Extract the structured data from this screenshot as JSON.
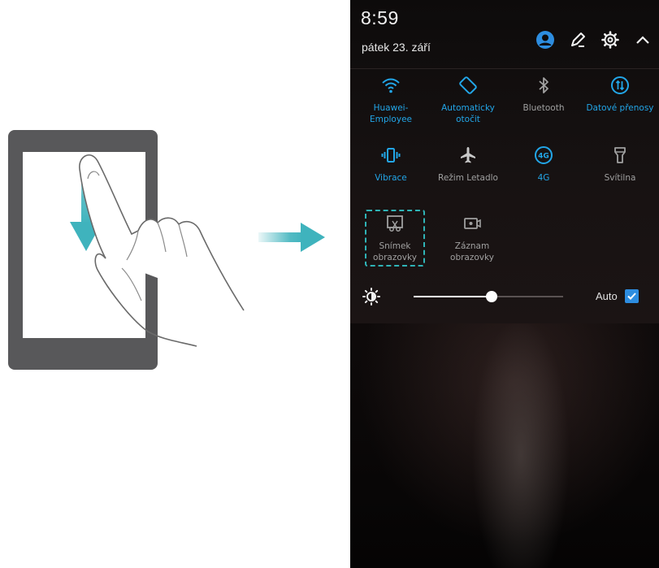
{
  "status": {
    "time": "8:59",
    "date": "pátek 23. září"
  },
  "header_icons": [
    "avatar-icon",
    "edit-icon",
    "settings-icon",
    "collapse-icon"
  ],
  "quick_settings": {
    "row1": [
      {
        "label": "Huawei-\nEmployee",
        "icon": "wifi-icon",
        "state": "on"
      },
      {
        "label": "Automaticky\notočit",
        "icon": "auto-rotate-icon",
        "state": "on"
      },
      {
        "label": "Bluetooth",
        "icon": "bluetooth-icon",
        "state": "off"
      },
      {
        "label": "Datové přenosy",
        "icon": "mobile-data-icon",
        "state": "on"
      }
    ],
    "row2": [
      {
        "label": "Vibrace",
        "icon": "vibrate-icon",
        "state": "on"
      },
      {
        "label": "Režim Letadlo",
        "icon": "airplane-icon",
        "state": "off"
      },
      {
        "label": "4G",
        "icon": "4g-icon",
        "state": "on"
      },
      {
        "label": "Svítilna",
        "icon": "flashlight-icon",
        "state": "off"
      }
    ],
    "row3": [
      {
        "label": "Snímek\nobrazovky",
        "icon": "screenshot-icon",
        "state": "off"
      },
      {
        "label": "Záznam\nobrazovky",
        "icon": "screen-record-icon",
        "state": "off"
      }
    ]
  },
  "brightness": {
    "level": 0.52,
    "auto_label": "Auto",
    "auto_checked": true
  },
  "colors": {
    "accent": "#22a6e8",
    "highlight": "#2fb3b6",
    "arrow": "#3fb3bd"
  }
}
